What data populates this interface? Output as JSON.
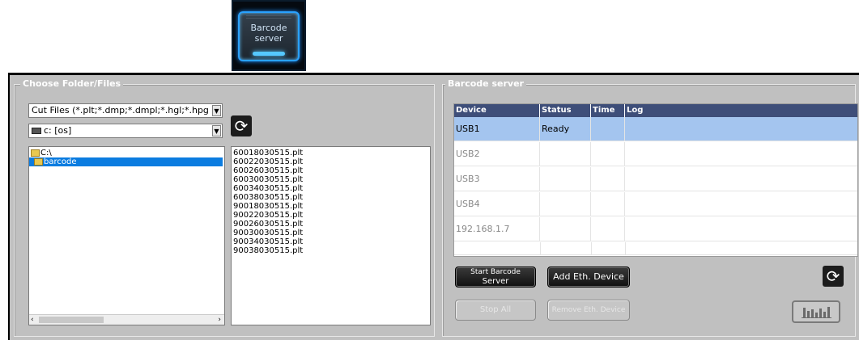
{
  "badge": {
    "label_line1": "Barcode",
    "label_line2": "server",
    "icon": "barcode-server-icon"
  },
  "folder_group": {
    "title": "Choose Folder/Files",
    "filter_combo": "Cut Files (*.plt;*.dmp;*.dmpl;*.hgl;*.hpg",
    "drive_combo": "c: [os]",
    "drive_icon": "drive-icon",
    "refresh_icon": "refresh-icon",
    "tree": [
      {
        "label": "C:\\",
        "selected": false,
        "icon": "folder-open-icon"
      },
      {
        "label": "barcode",
        "selected": true,
        "icon": "folder-open-icon"
      }
    ],
    "files": [
      "60018030515.plt",
      "60022030515.plt",
      "60026030515.plt",
      "60030030515.plt",
      "60034030515.plt",
      "60038030515.plt",
      "90018030515.plt",
      "90022030515.plt",
      "90026030515.plt",
      "90030030515.plt",
      "90034030515.plt",
      "90038030515.plt"
    ]
  },
  "server_group": {
    "title": "Barcode server",
    "columns": [
      "Device",
      "Status",
      "Time",
      "Log"
    ],
    "rows": [
      {
        "device": "USB1",
        "status": "Ready",
        "time": "",
        "log": "",
        "selected": true
      },
      {
        "device": "USB2",
        "status": "",
        "time": "",
        "log": "",
        "selected": false
      },
      {
        "device": "USB3",
        "status": "",
        "time": "",
        "log": "",
        "selected": false
      },
      {
        "device": "USB4",
        "status": "",
        "time": "",
        "log": "",
        "selected": false
      },
      {
        "device": "192.168.1.7",
        "status": "",
        "time": "",
        "log": "",
        "selected": false
      }
    ],
    "buttons": {
      "start_line1": "Start Barcode",
      "start_line2": "Server",
      "add_eth": "Add Eth. Device",
      "stop_all": "Stop All",
      "remove_eth": "Remove Eth. Device"
    },
    "refresh_icon": "refresh-icon",
    "levels_icon": "bar-levels-icon"
  },
  "colors": {
    "panel_bg": "#c0c0c0",
    "table_header": "#3e4e79",
    "row_selected": "#a4c5ef",
    "tree_selected": "#0b7ce0",
    "badge_glow": "#2aa2ff"
  }
}
